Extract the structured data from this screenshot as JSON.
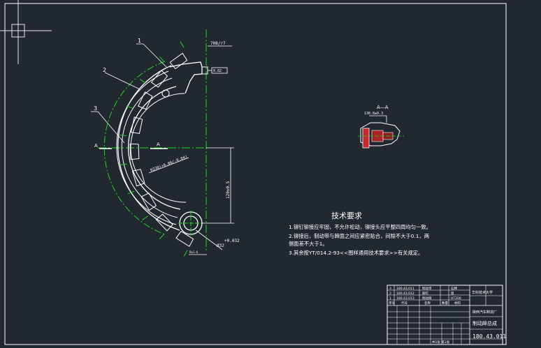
{
  "colors": {
    "background": "#212830",
    "line": "#ffffff",
    "centerline": "#1fd81f",
    "dimension": "#21c9d0",
    "section_red": "#c8282e"
  },
  "part_callouts": [
    "1",
    "2",
    "3"
  ],
  "section_label": "A",
  "section_view_title": "A—A",
  "dimensions": {
    "top_tol": "7H8/r7",
    "top_box": "0.02",
    "radius": "R230(+0.06/-0.04)",
    "vertical": "120±0.5",
    "bottom_tol": "+0.032",
    "bottom_dia": "Ø32",
    "bottom_small": "Ra1.6",
    "section_dim": "130.8±0.3"
  },
  "tech_requirements": {
    "title": "技术要求",
    "items": [
      "1.铆钉铆接应牢固，不允许松动，铆接头应平整四周均匀一致。",
      "2.铆接后，制动带与蹄面之间应紧密贴合，间隙不大于0.1，两",
      "  侧面差不大于1。",
      "3.其余按YT/014.2-93<<图样通用技术要求>>有关规定。"
    ]
  },
  "title_block": {
    "company": "陕西汽车制造厂",
    "school": "华科技术大学",
    "part_name": "制动蹄总成",
    "drawing_no": "180.43.011",
    "sheet": "共1张 第1张",
    "bom_rows": [
      {
        "no": "3",
        "code": "180.43.011",
        "name": "制动带",
        "material": "石棉"
      },
      {
        "no": "2",
        "code": "180.43.012",
        "name": "铆钉",
        "material": "铝"
      },
      {
        "no": "1",
        "code": "180.43.013",
        "name": "制动蹄",
        "material": "HT200"
      }
    ],
    "bom_header": [
      "序号",
      "代号",
      "名称",
      "数量",
      "材料"
    ]
  }
}
